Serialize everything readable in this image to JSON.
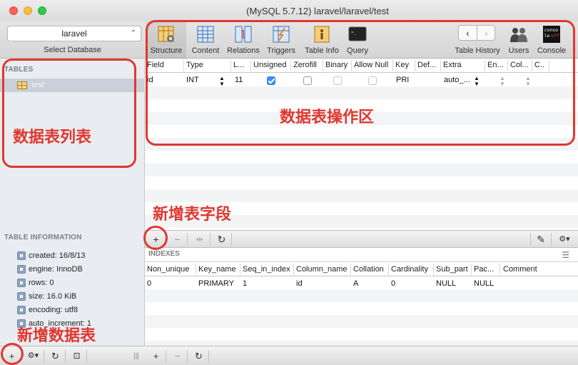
{
  "window": {
    "title": "(MySQL 5.7.12) laravel/laravel/test"
  },
  "sidebar": {
    "database": "laravel",
    "database_caption": "Select Database",
    "tables_header": "TABLES",
    "tables": [
      {
        "name": "test"
      }
    ],
    "info_header": "TABLE INFORMATION",
    "info": [
      "created: 16/8/13",
      "engine: InnoDB",
      "rows: 0",
      "size: 16.0 KiB",
      "encoding: utf8",
      "auto_increment: 1"
    ],
    "bottom": {
      "add": "+",
      "gear": "⚙▾",
      "refresh": "↻",
      "filter": "⊡",
      "handle": "|||"
    }
  },
  "toolbar": {
    "items": [
      {
        "label": "Structure"
      },
      {
        "label": "Content"
      },
      {
        "label": "Relations"
      },
      {
        "label": "Triggers"
      },
      {
        "label": "Table Info"
      },
      {
        "label": "Query"
      }
    ],
    "history_label": "Table History",
    "users_label": "Users",
    "console_label": "Console",
    "console_icon_text": {
      "line1": "conso",
      "line2": "le",
      "line3": "off"
    },
    "query_icon_text": ">_"
  },
  "structure": {
    "columns": [
      "Field",
      "Type",
      "L...",
      "Unsigned",
      "Zerofill",
      "Binary",
      "Allow Null",
      "Key",
      "Def...",
      "Extra",
      "En...",
      "Col...",
      "C.."
    ],
    "rows": [
      {
        "field": "id",
        "type": "INT",
        "length": "11",
        "unsigned": true,
        "zerofill": false,
        "binary": false,
        "allow_null": false,
        "key": "PRI",
        "default": "",
        "extra": "auto_...",
        "stepper": "⌃⌄"
      }
    ]
  },
  "field_bar": {
    "add": "+",
    "remove": "−",
    "duplicate": "⇹",
    "refresh": "↻",
    "edit": "✎",
    "gear": "⚙▾"
  },
  "indexes": {
    "title": "INDEXES",
    "columns": [
      "Non_unique",
      "Key_name",
      "Seq_in_index",
      "Column_name",
      "Collation",
      "Cardinality",
      "Sub_part",
      "Pac...",
      "Comment"
    ],
    "rows": [
      {
        "non_unique": "0",
        "key_name": "PRIMARY",
        "seq": "1",
        "column": "id",
        "collation": "A",
        "cardinality": "0",
        "sub_part": "NULL",
        "packed": "NULL",
        "comment": ""
      }
    ]
  },
  "index_bar": {
    "add": "+",
    "remove": "−",
    "refresh": "↻"
  },
  "annotations": {
    "table_list": "数据表列表",
    "operation_area": "数据表操作区",
    "add_field": "新增表字段",
    "add_table": "新增数据表"
  },
  "colors": {
    "annotation": "#e0372f",
    "checkbox_on": "#3d8ff3",
    "selected_row": "#c9d0d9"
  }
}
